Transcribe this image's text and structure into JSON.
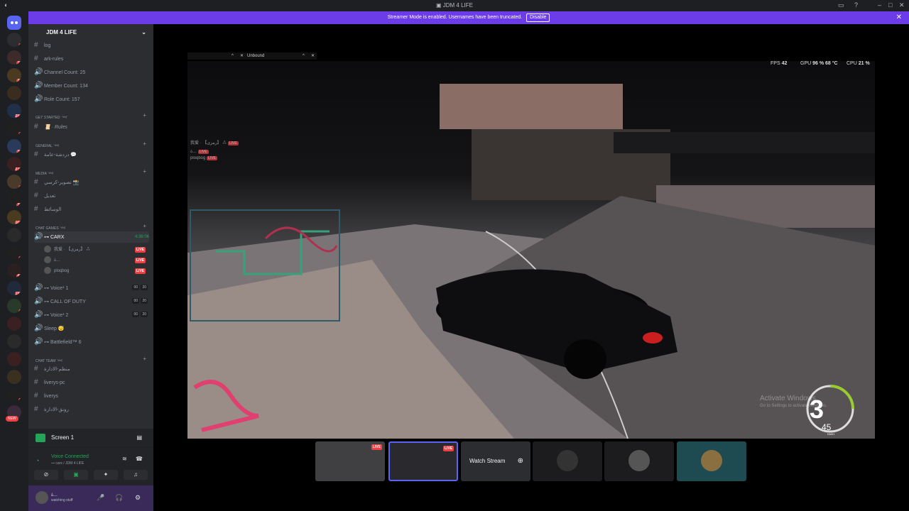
{
  "window": {
    "title": "JDM 4 LIFE"
  },
  "banner": {
    "text": "Streamer Mode is enabled. Usernames have been truncated.",
    "button": "Disable"
  },
  "guilds": [
    {
      "color": "#2b2d31",
      "badge": "1"
    },
    {
      "color": "#3d2a2a",
      "badge": "78"
    },
    {
      "color": "#4a3a20",
      "badge": "21"
    },
    {
      "color": "#3a2d20",
      "badge": ""
    },
    {
      "color": "#20304a",
      "badge": "297"
    },
    {
      "color": "#202020",
      "badge": "6"
    },
    {
      "color": "#2a3a5a",
      "badge": "35"
    },
    {
      "color": "#3a2020",
      "badge": "272"
    },
    {
      "color": "#4a3a2a",
      "badge": "1"
    },
    {
      "color": "#202020",
      "badge": "25"
    },
    {
      "color": "#4a3a20",
      "badge": "168"
    },
    {
      "color": "#2a2a2a",
      "badge": ""
    },
    {
      "color": "#202020",
      "badge": "6"
    },
    {
      "color": "#2a2020",
      "badge": "40"
    },
    {
      "color": "#202a3a",
      "badge": "193"
    },
    {
      "color": "#2a3a2a",
      "badge": "3"
    },
    {
      "color": "#3a2020",
      "badge": ""
    },
    {
      "color": "#2a2a2a",
      "badge": ""
    },
    {
      "color": "#3a2020",
      "badge": ""
    },
    {
      "color": "#3a3020",
      "badge": ""
    },
    {
      "color": "#202020",
      "badge": "3"
    },
    {
      "color": "#3a2a3a",
      "badge": ""
    }
  ],
  "new_badge": "NEW",
  "server": {
    "name": "JDM 4 LIFE"
  },
  "channels_top": [
    {
      "label": "log",
      "icon": "#"
    },
    {
      "label": "ark-rules",
      "icon": "#"
    },
    {
      "label": "Channel Count: 25",
      "icon": "🔊"
    },
    {
      "label": "Member Count: 134",
      "icon": "🔊"
    },
    {
      "label": "Role Count: 157",
      "icon": "🔊"
    }
  ],
  "categories": {
    "get_started": "Get Started ༺",
    "general": "GENERAL ༺",
    "media": "MEDIA ༺",
    "chat_games": "CHAT GAMES ༺",
    "chat_team": "CHAT TEAM ༺"
  },
  "rules_channel": "📜 · Rules",
  "general_channel": "دردشة-عامة 💬",
  "media_channels": [
    "تصوير-كرسي 📸",
    "تعديل",
    "الوسائط"
  ],
  "voice": {
    "carx": {
      "label": "⊶ CARX",
      "timer": "4:36:06"
    },
    "carx_users": [
      {
        "name": "我爱 · 【رمزی】 ⁂",
        "live": "LIVE"
      },
      {
        "name": "ﾑ…",
        "live": "LIVE"
      },
      {
        "name": "ploqbog",
        "live": "LIVE"
      }
    ],
    "others": [
      {
        "label": "⊶ Voice¹ 1",
        "c1": "00",
        "c2": "20"
      },
      {
        "label": "⊶ CALL OF DUTY",
        "c1": "00",
        "c2": "20"
      },
      {
        "label": "⊶ Voice¹ 2",
        "c1": "00",
        "c2": "20"
      },
      {
        "label": "Sleep 😴",
        "c1": "",
        "c2": ""
      },
      {
        "label": "⊶ Battlefield™ 6",
        "c1": "",
        "c2": ""
      }
    ]
  },
  "team_channels": [
    "منظم-الادارة",
    "liverys-pc",
    "liverys",
    "رونق-الادارة"
  ],
  "bottom": {
    "screen": "Screen 1",
    "voice_connected": "Voice Connected",
    "voice_sub": "⊶ carx / JDM 4 LIFE",
    "profile_name": "ﾑ…",
    "profile_status": "watching stuff"
  },
  "hud": {
    "fps_label": "FPS",
    "fps": "42",
    "gpu_label": "GPU",
    "gpu": "96 %  68 °C",
    "cpu_label": "CPU",
    "cpu": "21 %"
  },
  "game_tab": "Unbound",
  "overlay_users": [
    {
      "name": "我爱 · 【رمزی】 ⁂",
      "live": "LIVE"
    },
    {
      "name": "ﾑ…",
      "live": "LIVE"
    },
    {
      "name": "ploqbog",
      "live": "LIVE"
    }
  ],
  "speedo": {
    "gear": "3",
    "speed": "45",
    "unit": "KM/H"
  },
  "activate": {
    "line1": "Activate Windows",
    "line2": "Go to Settings to activate Windows."
  },
  "thumbs": {
    "live": "LIVE",
    "watch": "Watch Stream"
  }
}
